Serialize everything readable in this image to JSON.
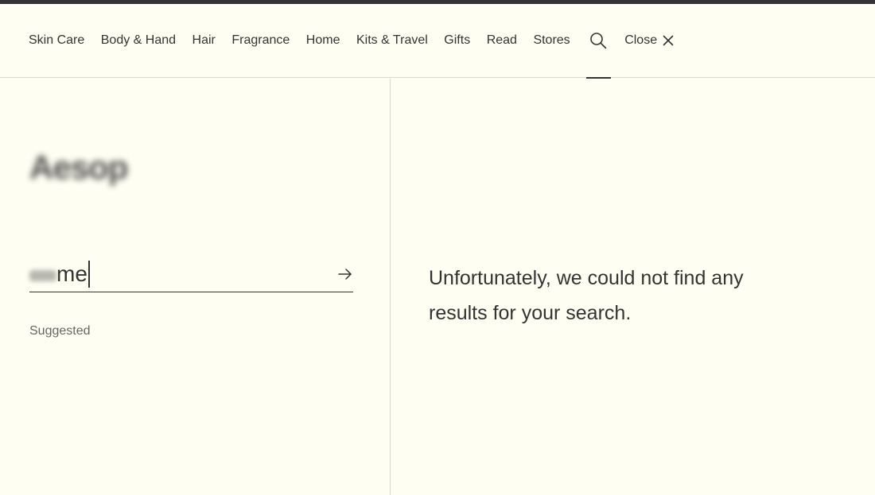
{
  "nav": {
    "items": [
      {
        "label": "Skin Care"
      },
      {
        "label": "Body & Hand"
      },
      {
        "label": "Hair"
      },
      {
        "label": "Fragrance"
      },
      {
        "label": "Home"
      },
      {
        "label": "Kits & Travel"
      },
      {
        "label": "Gifts"
      },
      {
        "label": "Read"
      },
      {
        "label": "Stores"
      }
    ],
    "search_icon": "search-icon",
    "close_label": "Close",
    "close_icon": "close-icon",
    "active": "search"
  },
  "brand": {
    "logo_text": "Aesop"
  },
  "search": {
    "value_visible": "me",
    "submit_icon": "arrow-right-icon",
    "suggested_label": "Suggested"
  },
  "results": {
    "message": "Unfortunately, we could not find any results for your search."
  },
  "colors": {
    "background": "#fffef2",
    "text": "#333333",
    "divider": "#d8d8cf"
  }
}
